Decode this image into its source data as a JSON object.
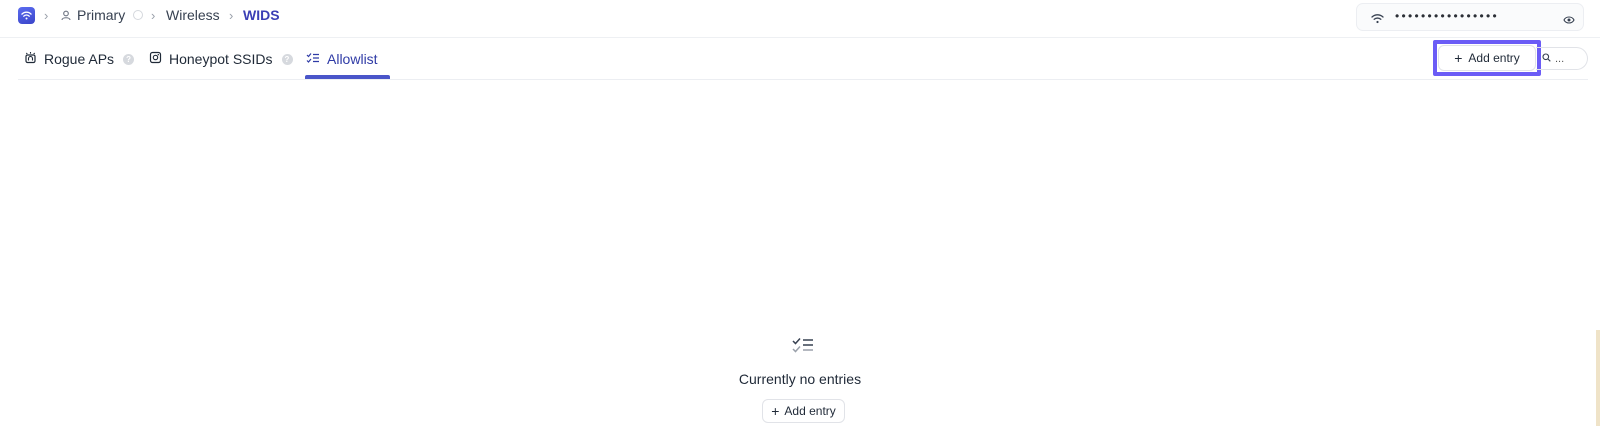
{
  "breadcrumb": {
    "site": "Primary",
    "section": "Wireless",
    "current": "WIDS"
  },
  "network_key": {
    "masked_value": "••••••••••••••••"
  },
  "tabs": [
    {
      "label": "Rogue APs",
      "help": "?"
    },
    {
      "label": "Honeypot SSIDs",
      "help": "?"
    },
    {
      "label": "Allowlist"
    }
  ],
  "toolbar": {
    "add_entry_label": "Add entry",
    "search_placeholder": "..."
  },
  "empty_state": {
    "message": "Currently no entries",
    "add_entry_label": "Add entry"
  },
  "colors": {
    "accent": "#3b3fb5",
    "tab_underline": "#4a55c9",
    "highlight": "#6b5cf6"
  }
}
